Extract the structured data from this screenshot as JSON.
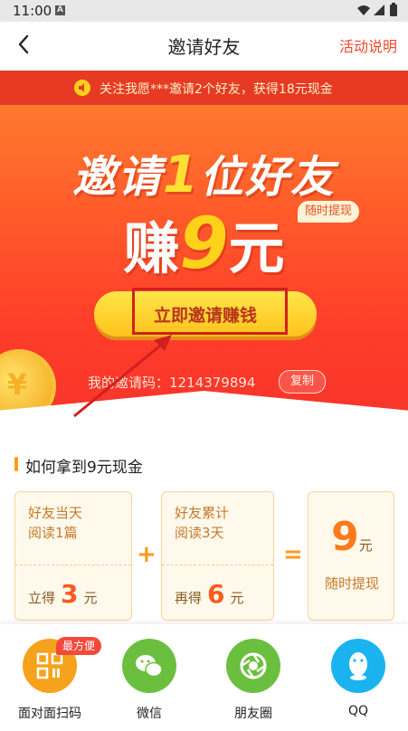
{
  "status_bar": {
    "time": "11:00",
    "notification_letter": "A"
  },
  "nav": {
    "title": "邀请好友",
    "rules_link": "活动说明"
  },
  "notice": {
    "text": "关注我愿***邀请2个好友，获得18元现金"
  },
  "hero": {
    "headline_prefix": "邀请",
    "headline_number": "1",
    "headline_suffix": "位好友",
    "earn_prefix": "赚",
    "earn_amount": "9",
    "earn_unit": "元",
    "badge": "随时提现",
    "invite_button": "立即邀请赚钱",
    "invite_code_label": "我的邀请码：",
    "invite_code": "1214379894",
    "copy_button": "复制"
  },
  "how_to": {
    "title": "如何拿到9元现金",
    "steps": [
      {
        "line1": "好友当天",
        "line2": "阅读1篇",
        "amount_prefix": "立得",
        "amount": "3",
        "unit": "元"
      },
      {
        "line1": "好友累计",
        "line2": "阅读3天",
        "amount_prefix": "再得",
        "amount": "6",
        "unit": "元"
      }
    ],
    "plus": "+",
    "equals": "=",
    "total": {
      "amount": "9",
      "unit": "元",
      "label": "随时提现"
    }
  },
  "share": {
    "best_badge": "最方便",
    "items": [
      {
        "label": "面对面扫码",
        "icon": "qr-code-icon",
        "color": "#f7a21c"
      },
      {
        "label": "微信",
        "icon": "wechat-icon",
        "color": "#6bbf3e"
      },
      {
        "label": "朋友圈",
        "icon": "moments-icon",
        "color": "#6bbf3e"
      },
      {
        "label": "QQ",
        "icon": "qq-icon",
        "color": "#1ab3f0"
      }
    ]
  },
  "colors": {
    "accent_red": "#e63a24",
    "gold": "#ffd21a",
    "orange": "#ff9a1a"
  }
}
